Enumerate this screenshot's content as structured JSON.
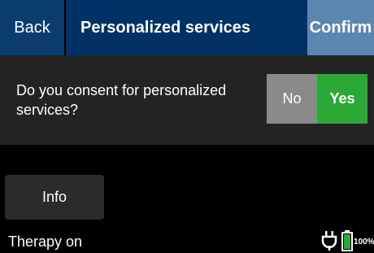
{
  "header": {
    "back_label": "Back",
    "title": "Personalized services",
    "confirm_label": "Confirm"
  },
  "consent": {
    "question": "Do you consent for personalized services?",
    "no_label": "No",
    "yes_label": "Yes",
    "selected": "Yes"
  },
  "info_label": "Info",
  "status": {
    "therapy_text": "Therapy on",
    "battery_percent": "100%",
    "battery_level": 1.0,
    "charging_icon": "plug-icon",
    "battery_icon": "battery-icon"
  },
  "colors": {
    "header_bg": "#003265",
    "confirm_bg": "#5b86b0",
    "yes_bg": "#2ca836",
    "no_bg": "#8a8a8a",
    "battery": "#2ca836"
  }
}
